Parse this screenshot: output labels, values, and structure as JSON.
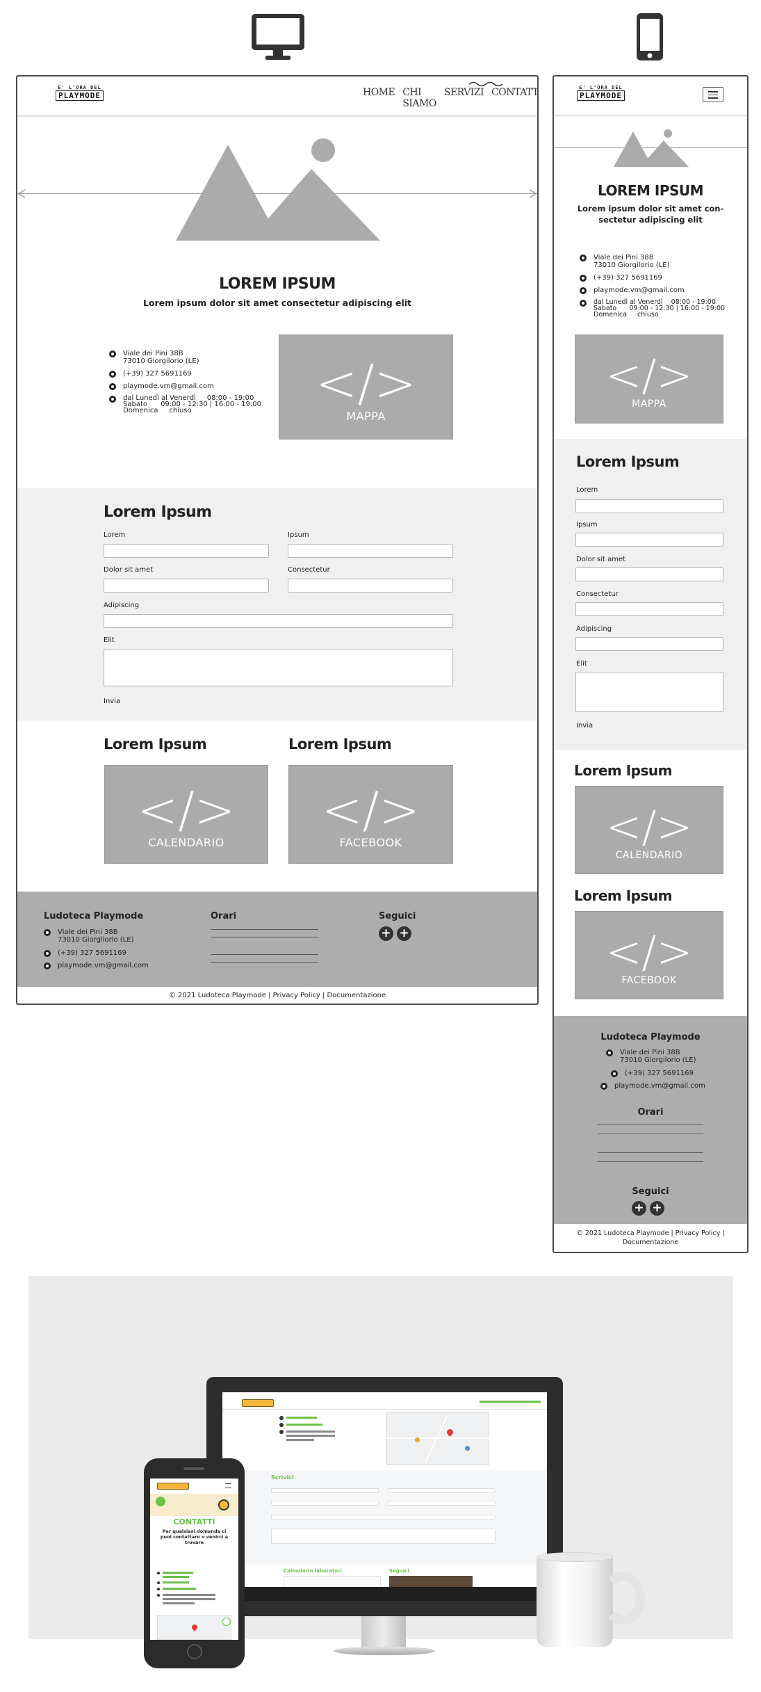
{
  "desktop": {
    "nav": [
      "HOME",
      "CHI SIAMO",
      "SERVIZI",
      "CONTATTI"
    ],
    "hero_title": "LOREM IPSUM",
    "hero_subtitle": "Lorem ipsum dolor sit amet consectetur adipiscing elit",
    "contact": {
      "address_1": "Viale dei Pini 38B",
      "address_2": "73010 Giorgilorio (LE)",
      "phone": "(+39) 327 5691169",
      "email": "playmode.vm@gmail.com",
      "hours_1": "dal Lunedì al Venerdì     08:00 - 19:00",
      "hours_2": "Sabato      09:00 - 12:30 | 16:00 - 19:00",
      "hours_3": "Domenica     chiuso"
    },
    "map_label": "MAPPA",
    "form_title": "Lorem Ipsum",
    "form_labels": [
      "Lorem",
      "Ipsum",
      "Dolor sit amet",
      "Consectetur",
      "Adipiscing",
      "Elit"
    ],
    "submit": "Invia",
    "section_titles": [
      "Lorem Ipsum",
      "Lorem Ipsum"
    ],
    "calendar_label": "CALENDARIO",
    "facebook_label": "FACEBOOK",
    "footer_brand": "Ludoteca Playmode",
    "footer_address_1": "Viale dei Pini 38B",
    "footer_address_2": "73010 Giorgilorio (LE)",
    "footer_phone": "(+39) 327 5691169",
    "footer_email": "playmode.vm@gmail.com",
    "footer_hours_title": "Orari",
    "footer_follow_title": "Seguici",
    "copyright": "© 2021 Ludoteca Playmode | Privacy Policy | Documentazione"
  },
  "mobile": {
    "hero_title": "LOREM IPSUM",
    "hero_subtitle_1": "Lorem ipsum dolor sit amet con-",
    "hero_subtitle_2": "sectetur adipiscing elit",
    "contact": {
      "address_1": "Viale dei Pini 38B",
      "address_2": "73010 Giorgilorio (LE)",
      "phone": "(+39) 327 5691169",
      "email": "playmode.vm@gmail.com",
      "hours_1": "dal Lunedì al Venerdì    08:00 - 19:00",
      "hours_2": "Sabato      09:00 - 12:30 | 16:00 - 19:00",
      "hours_3": "Domenica     chiuso"
    },
    "map_label": "MAPPA",
    "form_title": "Lorem Ipsum",
    "form_labels": [
      "Lorem",
      "Ipsum",
      "Dolor sit amet",
      "Consectetur",
      "Adipiscing",
      "Elit"
    ],
    "submit": "Invia",
    "section_titles": [
      "Lorem Ipsum",
      "Lorem Ipsum"
    ],
    "calendar_label": "CALENDARIO",
    "facebook_label": "FACEBOOK",
    "footer_brand": "Ludoteca Playmode",
    "footer_address_1": "Viale dei Pini 38B",
    "footer_address_2": "73010 Giorgilorio (LE)",
    "footer_phone": "(+39) 327 5691169",
    "footer_email": "playmode.vm@gmail.com",
    "footer_hours_title": "Orari",
    "footer_follow_title": "Seguici",
    "copyright_1": "© 2021 Ludoteca Playmode | Privacy Policy |",
    "copyright_2": "Documentazione"
  },
  "logo": {
    "top": "E' L'ORA DEL",
    "main": "PLAYMODE"
  },
  "code_glyph": "</>",
  "mockup": {
    "site_title": "CONTATTI",
    "site_text": "Per qualsiasi domanda ci puoi contattare o venirci a trovare",
    "desk_form_title": "Scrivici",
    "desk_calendar": "Calendario laboratori",
    "desk_follow": "Seguici"
  },
  "colors": {
    "placeholder": "#ababab",
    "band": "#f0f0f0",
    "footer": "#adadad",
    "accent_green": "#6cc24a"
  }
}
